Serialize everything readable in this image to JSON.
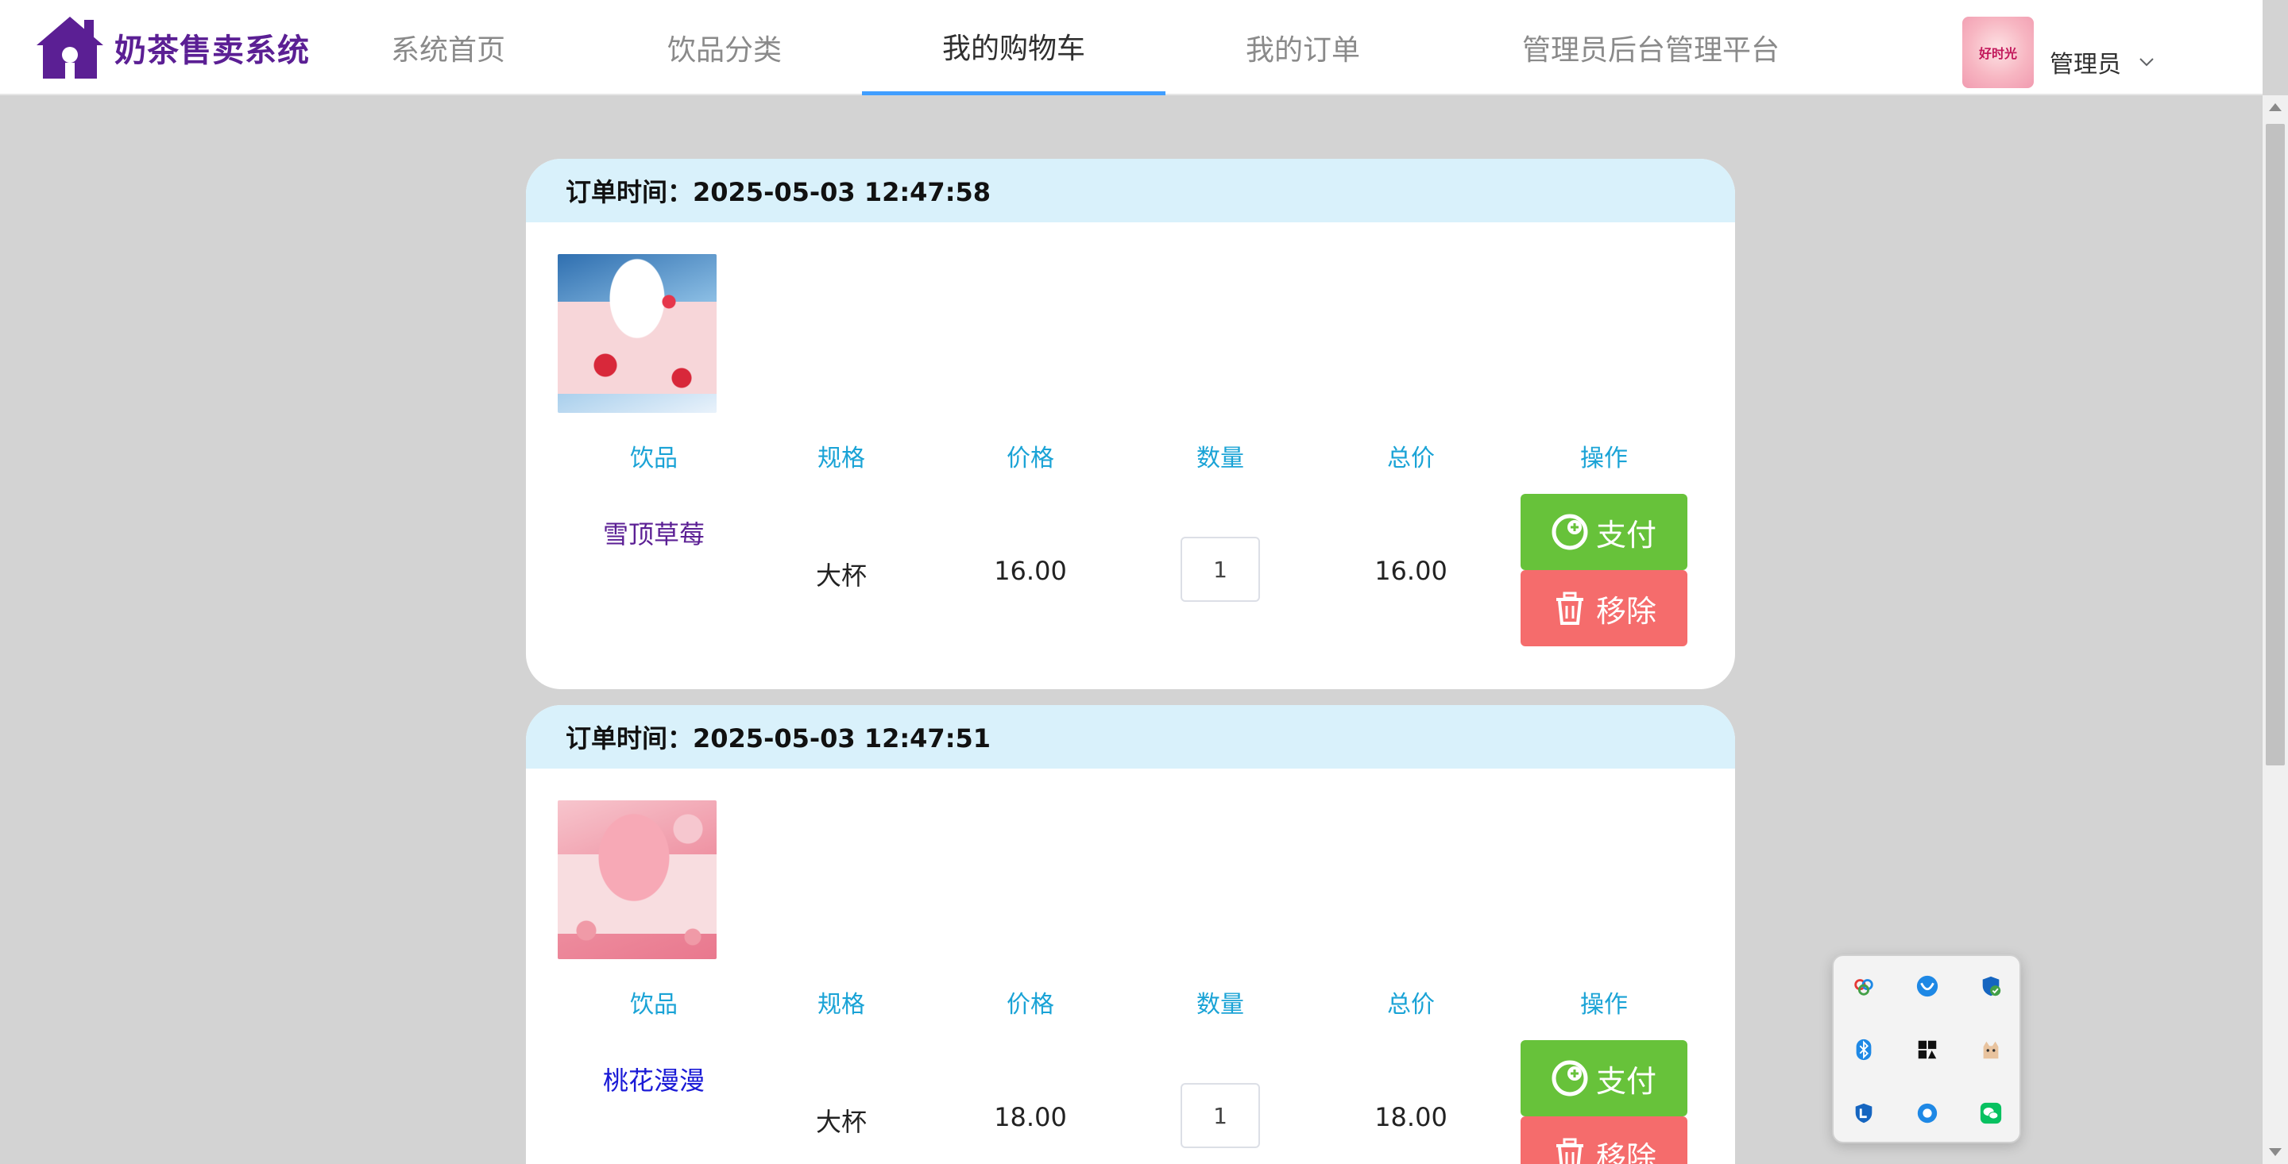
{
  "app": {
    "title": "奶茶售卖系统"
  },
  "nav": {
    "home": "系统首页",
    "category": "饮品分类",
    "cart": "我的购物车",
    "orders": "我的订单",
    "admin": "管理员后台管理平台",
    "active": "cart"
  },
  "user": {
    "name": "管理员",
    "avatar_text": "好时光"
  },
  "columns": [
    "饮品",
    "规格",
    "价格",
    "数量",
    "总价",
    "操作"
  ],
  "cart_items": [
    {
      "order_time": "订单时间：2025-05-03 12:47:58",
      "drink": "雪顶草莓",
      "spec": "大杯",
      "price": "16.00",
      "quantity": "1",
      "total": "16.00",
      "pay_label": "支付",
      "remove_label": "移除"
    },
    {
      "order_time": "订单时间：2025-05-03 12:47:51",
      "drink": "桃花漫漫",
      "spec": "大杯",
      "price": "18.00",
      "quantity": "1",
      "total": "18.00",
      "pay_label": "支付",
      "remove_label": "移除"
    }
  ],
  "tray_icons": [
    "baidu-netdisk-icon",
    "browser-icon",
    "security-shield-icon",
    "bluetooth-icon",
    "app-grid-icon",
    "cat-app-icon",
    "shield-app-icon",
    "chat-bubble-icon",
    "wechat-icon"
  ],
  "colors": {
    "brand": "#5b1f94",
    "nav_active_underline": "#409eff",
    "column_header": "#1aa3d6",
    "card_header_bg": "#d9f1fb",
    "pay_button": "#67c23a",
    "remove_button": "#f56c6c",
    "page_bg": "#d3d3d3"
  }
}
